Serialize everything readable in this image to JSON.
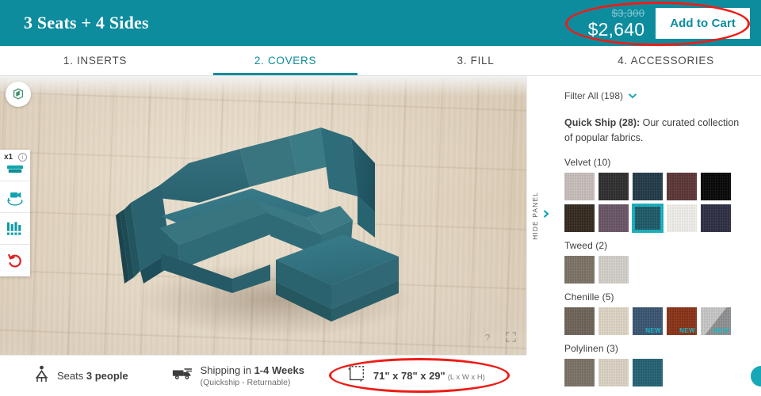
{
  "header": {
    "title": "3 Seats + 4 Sides",
    "price_original": "$3,300",
    "price_current": "$2,640",
    "add_to_cart_label": "Add to Cart",
    "accent_color": "#0d8c9e"
  },
  "tabs": [
    {
      "label": "1. INSERTS",
      "active": false
    },
    {
      "label": "2. COVERS",
      "active": true
    },
    {
      "label": "3. FILL",
      "active": false
    },
    {
      "label": "4. ACCESSORIES",
      "active": false
    }
  ],
  "viewport": {
    "logo_icon": "cube-logo-icon",
    "tools": [
      {
        "name": "module-count-tool",
        "badge": "x1",
        "info": "i",
        "icon": "sofa-module-icon"
      },
      {
        "name": "camera-rotate-tool",
        "icon": "camera-rotate-icon"
      },
      {
        "name": "fabric-swatch-tool",
        "icon": "fabric-bars-icon"
      },
      {
        "name": "reset-tool",
        "icon": "undo-arrow-icon"
      }
    ],
    "help_icon": "question-mark-icon",
    "fullscreen_icon": "expand-icon",
    "sofa_color": "#2e6b79",
    "floor_color": "#e3d6c2"
  },
  "hide_panel": {
    "label": "HIDE PANEL",
    "icon": "chevron-right-icon"
  },
  "bottom_bar": {
    "seats": {
      "icon": "person-seat-icon",
      "prefix": "Seats ",
      "value": "3 people"
    },
    "shipping": {
      "icon": "delivery-truck-icon",
      "prefix": "Shipping in ",
      "value": "1-4 Weeks",
      "sub": "(Quickship - Returnable)"
    },
    "dimensions": {
      "icon": "dimension-arrow-icon",
      "value": "71\" x 78\" x 29\"",
      "note": "(L x W x H)"
    }
  },
  "panel": {
    "filter": {
      "label": "Filter All (198)",
      "icon": "chevron-down-icon"
    },
    "quickship_bold": "Quick Ship (28):",
    "quickship_rest": " Our curated collection of popular fabrics.",
    "groups": [
      {
        "title": "Velvet (10)",
        "swatches": [
          {
            "name": "velvet-light-grey",
            "color": "#c9c0bd",
            "selected": false,
            "new": false
          },
          {
            "name": "velvet-charcoal",
            "color": "#2e2e2e",
            "selected": false,
            "new": false
          },
          {
            "name": "velvet-deep-teal",
            "color": "#213a48",
            "selected": false,
            "new": false
          },
          {
            "name": "velvet-burgundy",
            "color": "#5c3636",
            "selected": false,
            "new": false
          },
          {
            "name": "velvet-black",
            "color": "#060606",
            "selected": false,
            "new": false
          },
          {
            "name": "velvet-dark-brown",
            "color": "#34291f",
            "selected": false,
            "new": false
          },
          {
            "name": "velvet-plum",
            "color": "#6a5566",
            "selected": false,
            "new": false
          },
          {
            "name": "velvet-teal",
            "color": "#1d5b69",
            "selected": true,
            "new": false
          },
          {
            "name": "velvet-ivory",
            "color": "#f3f1ec",
            "selected": false,
            "new": false
          },
          {
            "name": "velvet-navy",
            "color": "#2d2e44",
            "selected": false,
            "new": false
          }
        ]
      },
      {
        "title": "Tweed (2)",
        "swatches": [
          {
            "name": "tweed-olive-grey",
            "color": "#7d7465",
            "selected": false,
            "new": false
          },
          {
            "name": "tweed-light-grey",
            "color": "#d4d2ca",
            "selected": false,
            "new": false
          }
        ]
      },
      {
        "title": "Chenille (5)",
        "swatches": [
          {
            "name": "chenille-taupe",
            "color": "#6f6458",
            "selected": false,
            "new": false
          },
          {
            "name": "chenille-cream",
            "color": "#e0d7c6",
            "selected": false,
            "new": false
          },
          {
            "name": "chenille-denim-blue",
            "color": "#3a5572",
            "selected": false,
            "new": true,
            "new_label": "NEW"
          },
          {
            "name": "chenille-rust",
            "color": "#8a3216",
            "selected": false,
            "new": true,
            "new_label": "NEW"
          },
          {
            "name": "chenille-grey-split",
            "color": "#a8aaac",
            "selected": false,
            "new": true,
            "new_label": "NEW",
            "diagonal": true
          }
        ]
      },
      {
        "title": "Polylinen (3)",
        "swatches": [
          {
            "name": "polylinen-taupe",
            "color": "#7c7267",
            "selected": false,
            "new": false
          },
          {
            "name": "polylinen-sand",
            "color": "#ded5c7",
            "selected": false,
            "new": false
          },
          {
            "name": "polylinen-teal",
            "color": "#236274",
            "selected": false,
            "new": false
          }
        ]
      }
    ]
  },
  "annotations": {
    "color": "#ee1c16",
    "items": [
      {
        "name": "price-highlight",
        "target": "price-block"
      },
      {
        "name": "dimensions-highlight",
        "target": "dimensions"
      }
    ]
  }
}
